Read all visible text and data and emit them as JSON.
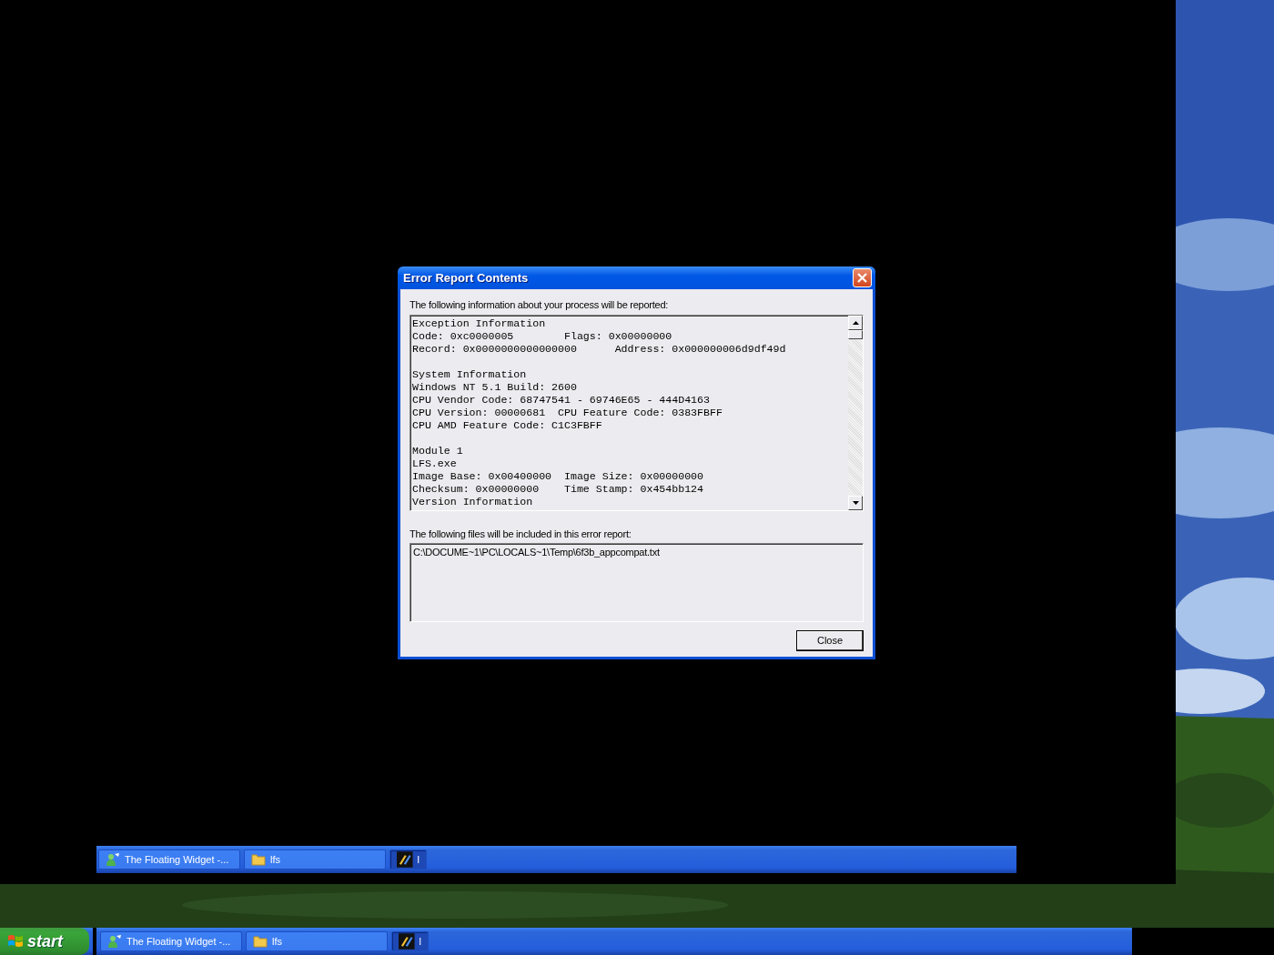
{
  "dialog": {
    "title": "Error Report Contents",
    "intro": "The following information about your process will be reported:",
    "report_sections": [
      [
        "Exception Information",
        "Code: 0xc0000005        Flags: 0x00000000",
        "Record: 0x0000000000000000      Address: 0x000000006d9df49d"
      ],
      [
        "System Information",
        "Windows NT 5.1 Build: 2600",
        "CPU Vendor Code: 68747541 - 69746E65 - 444D4163",
        "CPU Version: 00000681  CPU Feature Code: 0383FBFF",
        "CPU AMD Feature Code: C1C3FBFF"
      ],
      [
        "Module 1",
        "LFS.exe",
        "Image Base: 0x00400000  Image Size: 0x00000000",
        "Checksum: 0x00000000    Time Stamp: 0x454bb124",
        "Version Information"
      ]
    ],
    "files_label": "The following files will be included in this error report:",
    "files": [
      "C:\\DOCUME~1\\PC\\LOCALS~1\\Temp\\6f3b_appcompat.txt"
    ],
    "buttons": [
      "Close"
    ]
  },
  "inner_taskbar": {
    "buttons": [
      {
        "label": "The Floating Widget -...",
        "kind": "widget",
        "selected": false
      },
      {
        "label": "lfs",
        "kind": "folder",
        "selected": false
      },
      {
        "label": "l",
        "kind": "app",
        "selected": true
      }
    ]
  },
  "taskbar": {
    "start_button": {
      "label": "start"
    },
    "buttons": [
      {
        "label": "The Floating Widget -...",
        "kind": "widget",
        "selected": false
      },
      {
        "label": "lfs",
        "kind": "folder",
        "selected": false
      },
      {
        "label": "l",
        "kind": "app",
        "selected": true
      }
    ]
  }
}
